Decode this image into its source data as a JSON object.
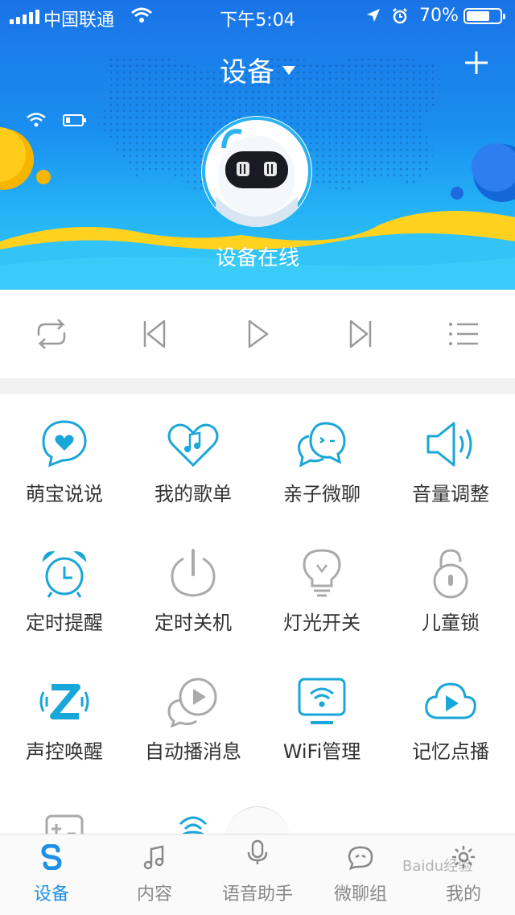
{
  "status_bar": {
    "carrier": "中国联通",
    "time": "下午5:04",
    "battery_pct": "70%",
    "battery_level": 0.7
  },
  "header": {
    "title": "设备",
    "add_icon": "plus-icon"
  },
  "device": {
    "status_text": "设备在线",
    "battery_level": 0.3
  },
  "controls": [
    {
      "icon": "repeat-icon"
    },
    {
      "icon": "previous-icon"
    },
    {
      "icon": "play-icon"
    },
    {
      "icon": "next-icon"
    },
    {
      "icon": "playlist-icon"
    }
  ],
  "features": [
    {
      "label": "萌宝说说",
      "icon": "heart-chat-icon"
    },
    {
      "label": "我的歌单",
      "icon": "music-heart-icon"
    },
    {
      "label": "亲子微聊",
      "icon": "chat-bubbles-icon"
    },
    {
      "label": "音量调整",
      "icon": "speaker-icon"
    },
    {
      "label": "定时提醒",
      "icon": "alarm-clock-icon"
    },
    {
      "label": "定时关机",
      "icon": "power-icon"
    },
    {
      "label": "灯光开关",
      "icon": "bulb-icon"
    },
    {
      "label": "儿童锁",
      "icon": "lock-icon"
    },
    {
      "label": "声控唤醒",
      "icon": "voice-wake-icon"
    },
    {
      "label": "自动播消息",
      "icon": "auto-play-icon"
    },
    {
      "label": "WiFi管理",
      "icon": "wifi-tv-icon"
    },
    {
      "label": "记忆点播",
      "icon": "cloud-play-icon"
    }
  ],
  "tabs": [
    {
      "label": "设备",
      "icon": "device-icon",
      "active": true
    },
    {
      "label": "内容",
      "icon": "music-note-icon",
      "active": false
    },
    {
      "label": "语音助手",
      "icon": "microphone-icon",
      "active": false
    },
    {
      "label": "微聊组",
      "icon": "chat-group-icon",
      "active": false
    },
    {
      "label": "我的",
      "icon": "settings-gear-icon",
      "active": false
    }
  ],
  "colors": {
    "accent": "#1e90e8",
    "icon_cyan": "#19a6d8",
    "icon_gray": "#aaaaaa"
  },
  "watermark": "Baidu经验"
}
